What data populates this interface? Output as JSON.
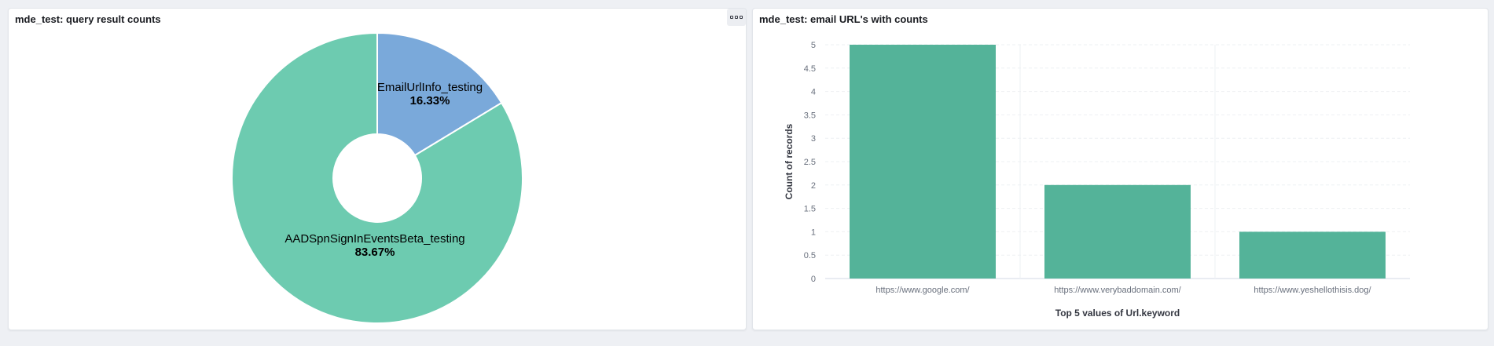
{
  "panels": {
    "left": {
      "title": "mde_test: query result counts",
      "options_icon": "more-options-icon"
    },
    "right": {
      "title": "mde_test: email URL's with counts"
    }
  },
  "chart_data": [
    {
      "type": "pie",
      "donut": true,
      "slices": [
        {
          "label": "EmailUrlInfo_testing",
          "percent_label": "16.33%",
          "value": 16.33,
          "color": "#7aa9da"
        },
        {
          "label": "AADSpnSignInEventsBeta_testing",
          "percent_label": "83.67%",
          "value": 83.67,
          "color": "#6dcbb0"
        }
      ]
    },
    {
      "type": "bar",
      "categories": [
        "https://www.google.com/",
        "https://www.verybaddomain.com/",
        "https://www.yeshellothisis.dog/"
      ],
      "values": [
        5,
        2,
        1
      ],
      "xlabel": "Top 5 values of Url.keyword",
      "ylabel": "Count of records",
      "ylim": [
        0,
        5
      ],
      "yticks": [
        "0",
        "0.5",
        "1",
        "1.5",
        "2",
        "2.5",
        "3",
        "3.5",
        "4",
        "4.5",
        "5"
      ],
      "color": "#54b399",
      "grid": true
    }
  ]
}
